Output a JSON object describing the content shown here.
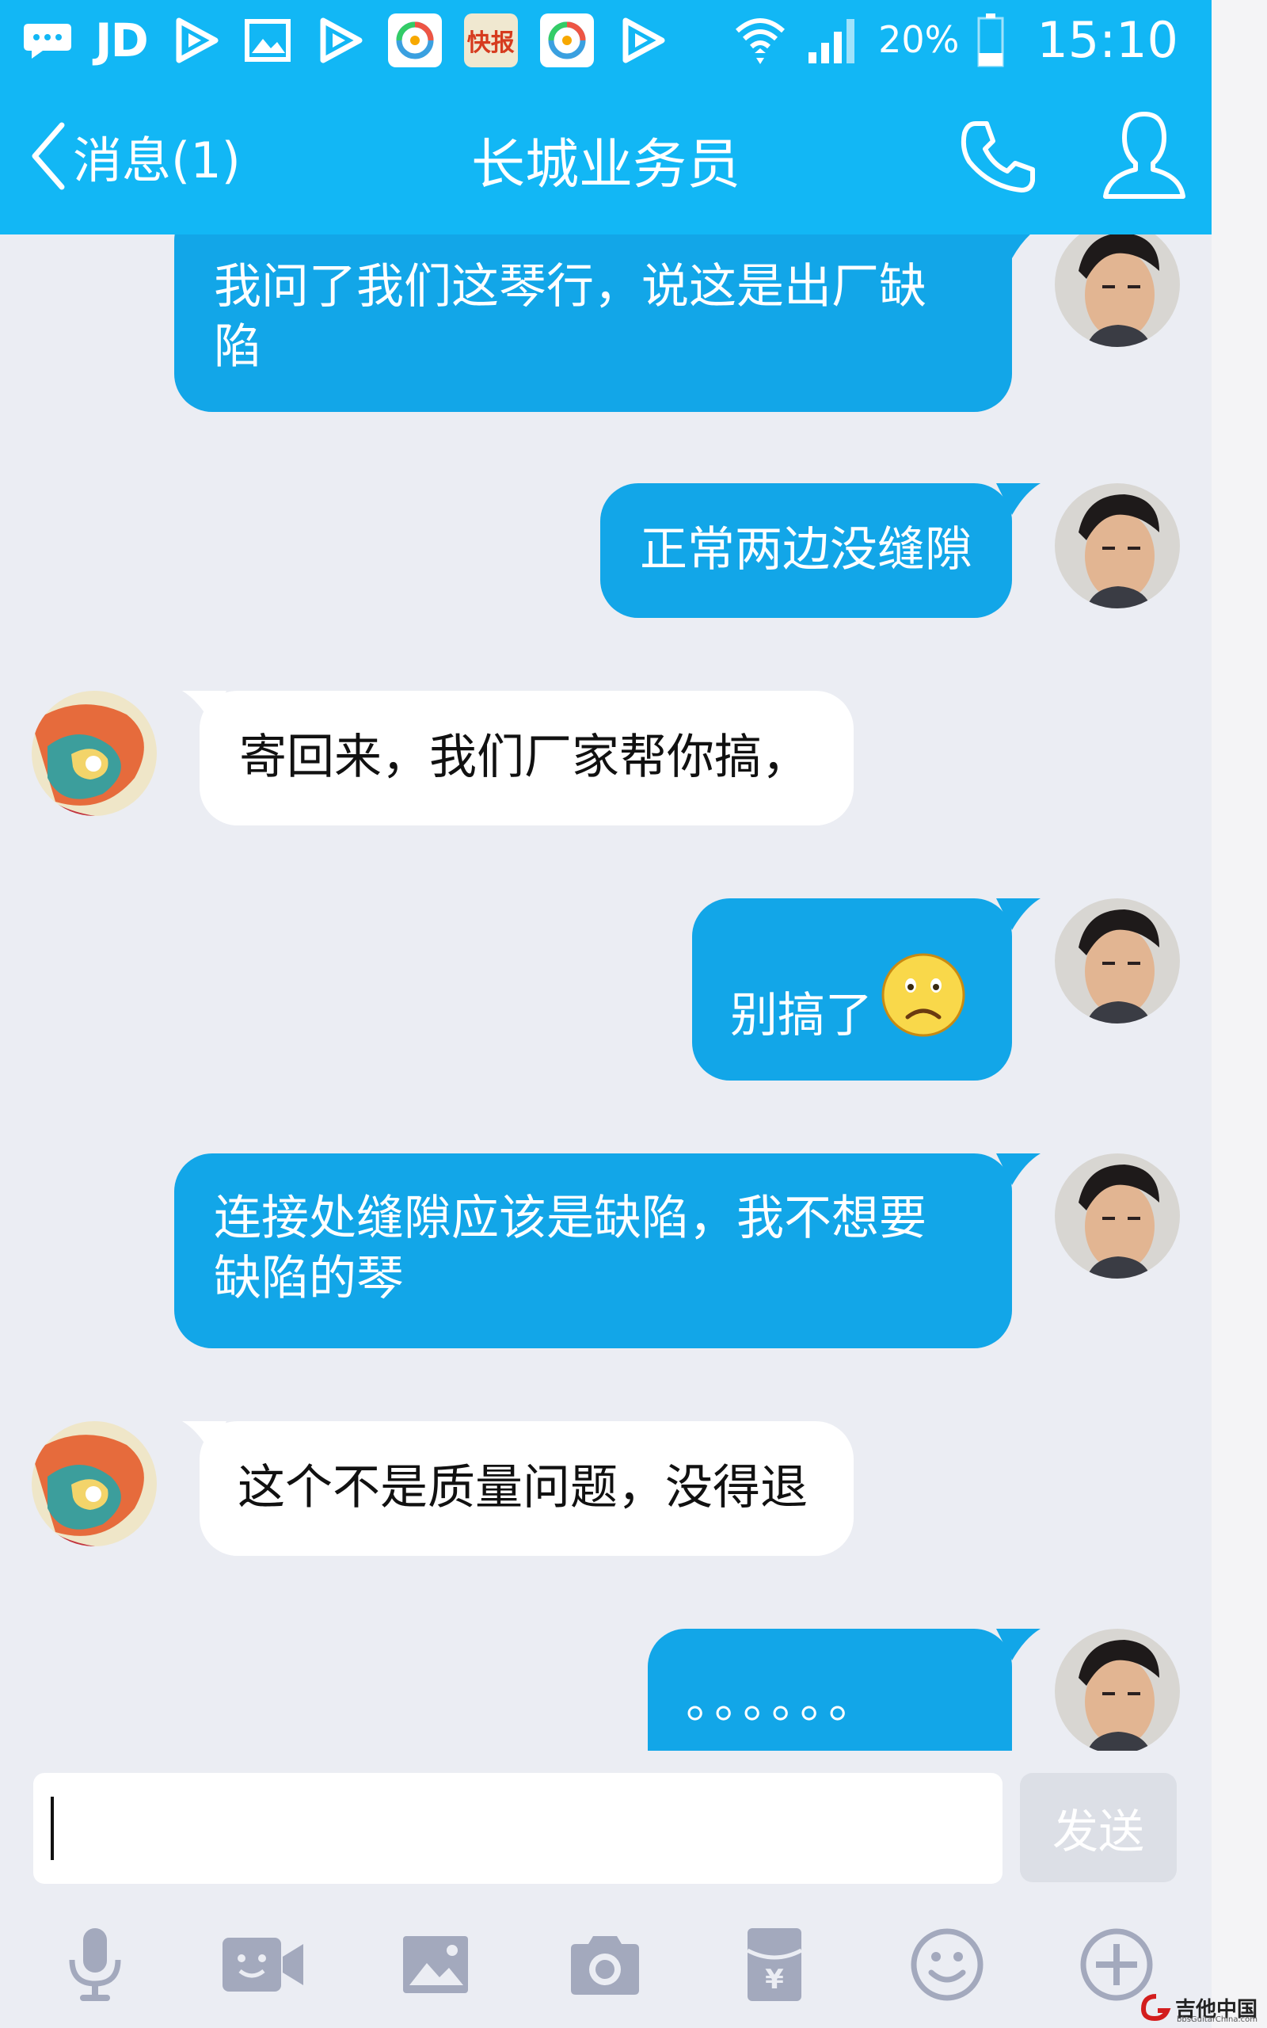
{
  "status_bar": {
    "left_icons": [
      "message-icon",
      "jd-icon",
      "play-icon",
      "gallery-icon",
      "play-icon",
      "app-icon",
      "kuaibao-icon",
      "app-icon",
      "play-icon"
    ],
    "jd_label": "JD",
    "kuaibao_label": "快报",
    "battery_percent": "20%",
    "time": "15:10"
  },
  "nav": {
    "back_label": "消息(1)",
    "title": "长城业务员"
  },
  "messages": [
    {
      "direction": "out",
      "text_lines": [
        "我问了我们这琴行，说这是出厂缺",
        "陷"
      ]
    },
    {
      "direction": "out",
      "text_lines": [
        "正常两边没缝隙"
      ]
    },
    {
      "direction": "in",
      "text_lines": [
        "寄回来，我们厂家帮你搞，"
      ]
    },
    {
      "direction": "out",
      "text_lines": [
        "别搞了"
      ],
      "emoji": "sad-face"
    },
    {
      "direction": "out",
      "text_lines": [
        "连接处缝隙应该是缺陷，我不想要",
        "缺陷的琴"
      ]
    },
    {
      "direction": "in",
      "text_lines": [
        "这个不是质量问题，没得退"
      ]
    },
    {
      "direction": "out",
      "text_lines": [
        "。。。。。。"
      ]
    }
  ],
  "input": {
    "value": "",
    "send_label": "发送"
  },
  "toolbar": [
    "microphone-icon",
    "video-icon",
    "image-icon",
    "camera-icon",
    "red-packet-icon",
    "emoji-icon",
    "plus-icon"
  ],
  "watermark": {
    "text": "吉他中国",
    "sub": "bbsGuitarChina.com"
  },
  "colors": {
    "accent": "#12b7f5",
    "outgoing_bubble": "#12a6e8",
    "incoming_bubble": "#ffffff",
    "background": "#ebedf3",
    "toolbar_icon": "#a3a9bd"
  }
}
